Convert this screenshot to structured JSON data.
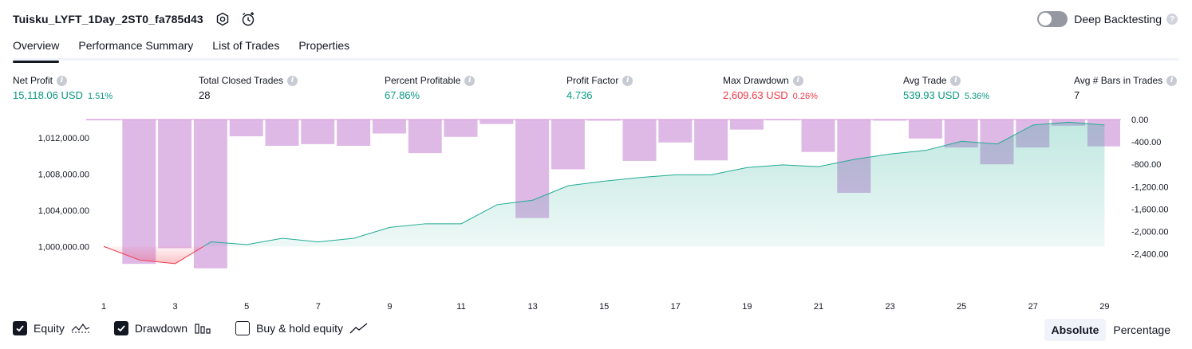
{
  "header": {
    "title": "Tuisku_LYFT_1Day_2ST0_fa785d43"
  },
  "deep_backtesting": {
    "label": "Deep Backtesting",
    "enabled": false,
    "help": "?"
  },
  "tabs": [
    {
      "label": "Overview",
      "active": true
    },
    {
      "label": "Performance Summary",
      "active": false
    },
    {
      "label": "List of Trades",
      "active": false
    },
    {
      "label": "Properties",
      "active": false
    }
  ],
  "stats": [
    {
      "label": "Net Profit",
      "value": "15,118.06 USD",
      "pct": "1.51%",
      "color": "green"
    },
    {
      "label": "Total Closed Trades",
      "value": "28",
      "pct": "",
      "color": "dark"
    },
    {
      "label": "Percent Profitable",
      "value": "67.86%",
      "pct": "",
      "color": "green"
    },
    {
      "label": "Profit Factor",
      "value": "4.736",
      "pct": "",
      "color": "green"
    },
    {
      "label": "Max Drawdown",
      "value": "2,609.63 USD",
      "pct": "0.26%",
      "color": "red"
    },
    {
      "label": "Avg Trade",
      "value": "539.93 USD",
      "pct": "5.36%",
      "color": "green"
    },
    {
      "label": "Avg # Bars in Trades",
      "value": "7",
      "pct": "",
      "color": "dark"
    }
  ],
  "chart_data": {
    "type": "line",
    "x": [
      1,
      2,
      3,
      4,
      5,
      6,
      7,
      8,
      9,
      10,
      11,
      12,
      13,
      14,
      15,
      16,
      17,
      18,
      19,
      20,
      21,
      22,
      23,
      24,
      25,
      26,
      27,
      28,
      29
    ],
    "x_tick_labels": [
      "1",
      "3",
      "5",
      "7",
      "9",
      "11",
      "13",
      "15",
      "17",
      "19",
      "21",
      "23",
      "25",
      "27",
      "29"
    ],
    "series": [
      {
        "name": "Equity",
        "values": [
          1000000,
          998500,
          998100,
          1000500,
          1000200,
          1000900,
          1000500,
          1000900,
          1002100,
          1002500,
          1002500,
          1004600,
          1005100,
          1006700,
          1007200,
          1007600,
          1007900,
          1007900,
          1008700,
          1009000,
          1008800,
          1009600,
          1010200,
          1010600,
          1011600,
          1011300,
          1013400,
          1013700,
          1013400
        ],
        "color": "#22ab94",
        "negative_color": "#f23645"
      },
      {
        "name": "Drawdown",
        "values": [
          -5,
          -2580,
          -2300,
          -2660,
          -300,
          -470,
          -440,
          -470,
          -250,
          -600,
          -310,
          -80,
          -1760,
          -890,
          -20,
          -740,
          -410,
          -730,
          -180,
          -10,
          -580,
          -1310,
          -20,
          -340,
          -500,
          -800,
          -500,
          -110,
          -480
        ],
        "color": "#ce93d8"
      }
    ],
    "y_left": {
      "ticks": [
        "1,000,000.00",
        "1,004,000.00",
        "1,008,000.00",
        "1,012,000.00"
      ],
      "range": [
        998000,
        1014000
      ]
    },
    "y_right": {
      "ticks": [
        "0.00",
        "-400.00",
        "-800.00",
        "-1,200.00",
        "-1,600.00",
        "-2,000.00",
        "-2,400.00"
      ],
      "range": [
        -2720,
        0
      ]
    }
  },
  "legend": [
    {
      "label": "Equity",
      "checked": true,
      "icon": "equity-line-icon"
    },
    {
      "label": "Drawdown",
      "checked": true,
      "icon": "drawdown-bars-icon"
    },
    {
      "label": "Buy & hold equity",
      "checked": false,
      "icon": "buy-hold-line-icon"
    }
  ],
  "view_mode": [
    {
      "label": "Absolute",
      "active": true
    },
    {
      "label": "Percentage",
      "active": false
    }
  ]
}
